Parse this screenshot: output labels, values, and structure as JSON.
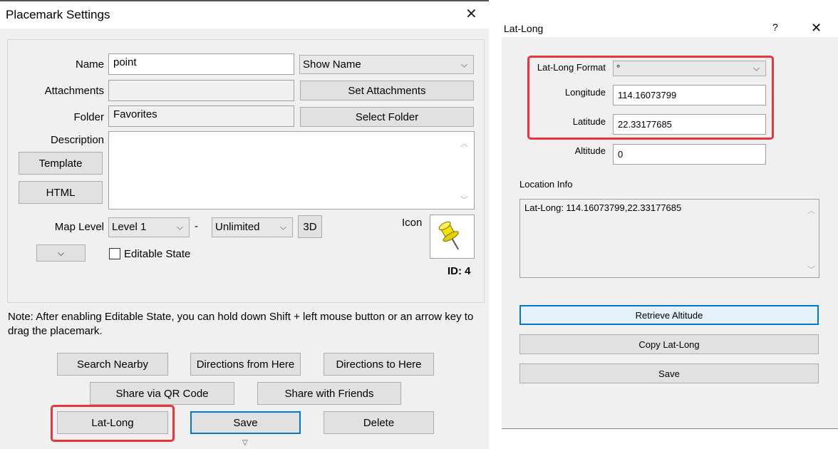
{
  "placemark": {
    "title": "Placemark Settings",
    "close_glyph": "✕",
    "name_label": "Name",
    "name_value": "point",
    "show_name_option": "Show Name",
    "attachments_label": "Attachments",
    "attachments_value": "",
    "set_attachments_label": "Set Attachments",
    "folder_label": "Folder",
    "folder_value": "Favorites",
    "select_folder_label": "Select Folder",
    "description_label": "Description",
    "template_label": "Template",
    "html_label": "HTML",
    "description_value": "",
    "map_level_label": "Map Level",
    "map_level_from": "Level 1",
    "map_level_dash": "-",
    "map_level_to": "Unlimited",
    "three_d_label": "3D",
    "icon_label": "Icon",
    "id_label": "ID: 4",
    "editable_state_label": "Editable State",
    "note_text": "Note: After enabling Editable State, you can hold down Shift + left mouse button or an arrow key to drag the placemark.",
    "search_nearby_label": "Search Nearby",
    "directions_from_label": "Directions from Here",
    "directions_to_label": "Directions to Here",
    "share_qr_label": "Share via QR Code",
    "share_friends_label": "Share with Friends",
    "lat_long_label": "Lat-Long",
    "save_label": "Save",
    "delete_label": "Delete",
    "pin_icon": "pushpin-icon",
    "pin_color": "#f5e100",
    "highlight_color": "#e8363c"
  },
  "latlong": {
    "title": "Lat-Long",
    "help_glyph": "?",
    "close_glyph": "✕",
    "format_label": "Lat-Long Format",
    "format_value": "°",
    "longitude_label": "Longitude",
    "longitude_value": "114.16073799",
    "latitude_label": "Latitude",
    "latitude_value": "22.33177685",
    "altitude_label": "Altitude",
    "altitude_value": "0",
    "location_info_label": "Location Info",
    "location_info_value": "Lat-Long: 114.16073799,22.33177685",
    "retrieve_altitude_label": "Retrieve Altitude",
    "copy_latlong_label": "Copy Lat-Long",
    "save_label": "Save"
  }
}
